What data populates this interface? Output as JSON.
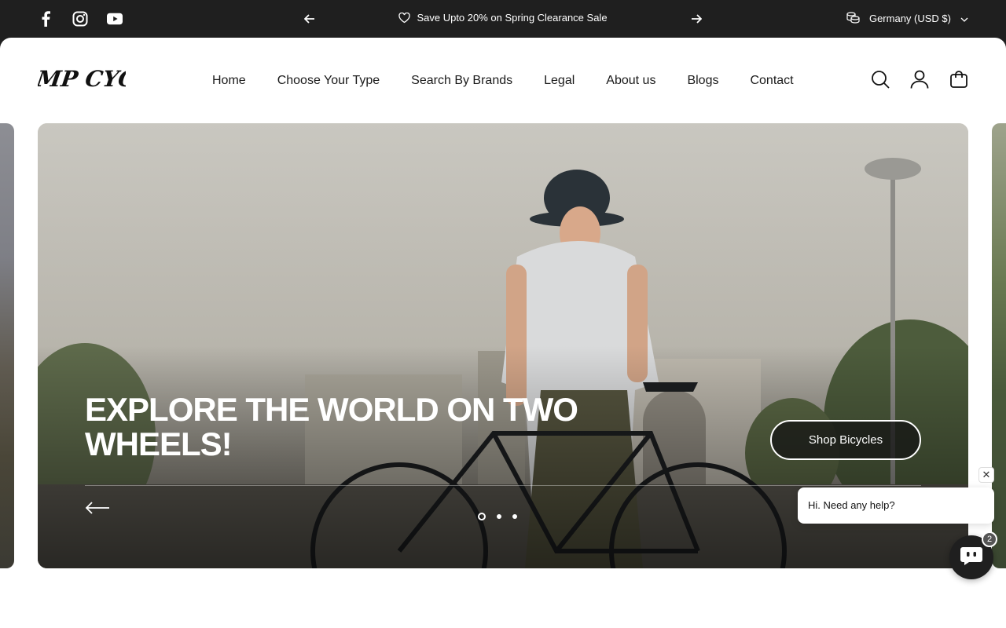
{
  "announcement": {
    "social": [
      "facebook-icon",
      "instagram-icon",
      "youtube-icon"
    ],
    "message": "Save Upto 20% on Spring Clearance Sale",
    "message_icon": "heart-icon",
    "locale": "Germany (USD $)",
    "locale_icon": "coins-icon"
  },
  "header": {
    "logo_text": "MP CYCLE",
    "nav": [
      "Home",
      "Choose Your Type",
      "Search By Brands",
      "Legal",
      "About us",
      "Blogs",
      "Contact"
    ],
    "icons": [
      "search-icon",
      "account-icon",
      "cart-icon"
    ]
  },
  "hero": {
    "title": "EXPLORE THE WORLD ON TWO WHEELS!",
    "button": "Shop Bicycles",
    "slides": 3,
    "active_slide": 1
  },
  "chat": {
    "message": "Hi. Need any help?",
    "close": "✕",
    "badge": "2"
  },
  "colors": {
    "topbar": "#1f1f1f",
    "accent": "#ffffff"
  }
}
